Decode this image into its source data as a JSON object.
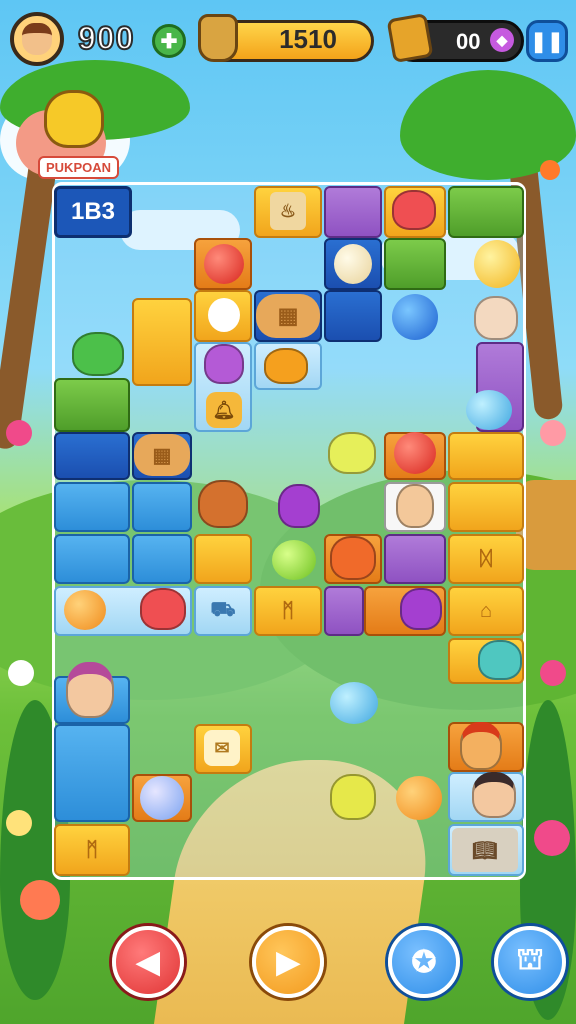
{
  "hud": {
    "score": "900",
    "coins": "1510",
    "gems": "00"
  },
  "badge_label": "PUKPOAN",
  "level_label": "1B3",
  "icons": {
    "avatar": "player-avatar-icon",
    "add": "plus-icon",
    "coin": "coin-sack-icon",
    "gem": "chest-icon",
    "pause": "pause-icon",
    "prev": "left-arrow-icon",
    "next": "right-arrow-icon",
    "hint": "magnifier-icon",
    "menu": "map-icon"
  },
  "colors": {
    "prev_button": "#e03434",
    "next_button": "#f39a1e",
    "hint_button": "#2f8ee8",
    "menu_button": "#2f8ee8"
  }
}
